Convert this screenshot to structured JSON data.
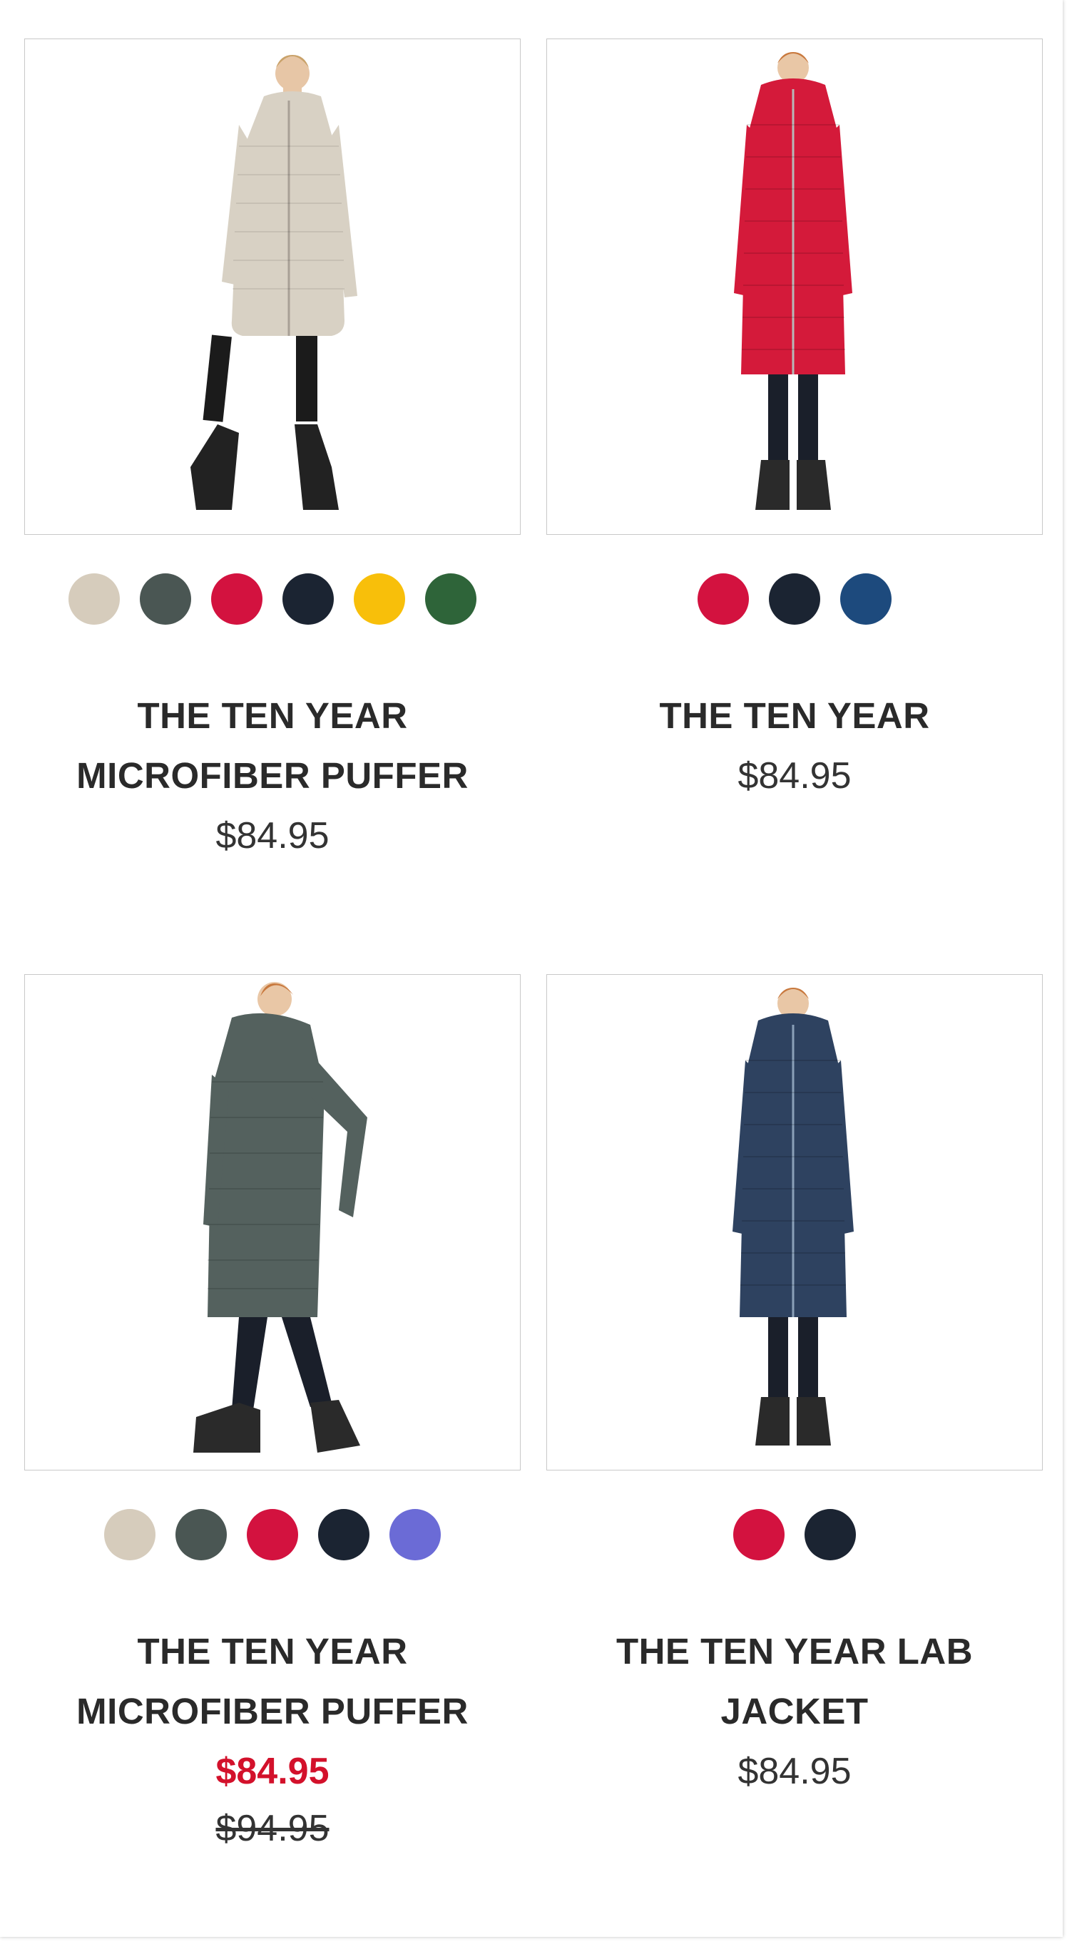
{
  "products": [
    {
      "coat_color": "#d8d1c4",
      "swatches": [
        {
          "name": "beige",
          "color": "#d6ccbc"
        },
        {
          "name": "slate",
          "color": "#4a5653"
        },
        {
          "name": "red",
          "color": "#d3123f"
        },
        {
          "name": "navy",
          "color": "#1b2432"
        },
        {
          "name": "yellow",
          "color": "#f8bf0a"
        },
        {
          "name": "green",
          "color": "#2e6439"
        }
      ],
      "title": "THE TEN YEAR MICROFIBER PUFFER",
      "price": "$84.95",
      "sale_price": "",
      "original_price": ""
    },
    {
      "coat_color": "#d41a3a",
      "swatches": [
        {
          "name": "red",
          "color": "#d3123f"
        },
        {
          "name": "navy",
          "color": "#1b2432"
        },
        {
          "name": "blue",
          "color": "#1d4a7d"
        }
      ],
      "title": "THE TEN YEAR",
      "price": "$84.95",
      "sale_price": "",
      "original_price": ""
    },
    {
      "coat_color": "#54615e",
      "swatches": [
        {
          "name": "beige",
          "color": "#d6ccbc"
        },
        {
          "name": "slate",
          "color": "#4a5653"
        },
        {
          "name": "red",
          "color": "#d3123f"
        },
        {
          "name": "navy",
          "color": "#1b2432"
        },
        {
          "name": "periwinkle",
          "color": "#6b6bd6"
        }
      ],
      "title": "THE TEN YEAR MICROFIBER PUFFER",
      "price": "",
      "sale_price": "$84.95",
      "original_price": "$94.95"
    },
    {
      "coat_color": "#2e4260",
      "swatches": [
        {
          "name": "red",
          "color": "#d3123f"
        },
        {
          "name": "navy",
          "color": "#1b2432"
        }
      ],
      "title": "THE TEN YEAR LAB JACKET",
      "price": "$84.95",
      "sale_price": "",
      "original_price": ""
    }
  ],
  "colors": {
    "sale": "#d3112b",
    "card_border": "#c8c8c8",
    "text": "#2a2a2a"
  }
}
